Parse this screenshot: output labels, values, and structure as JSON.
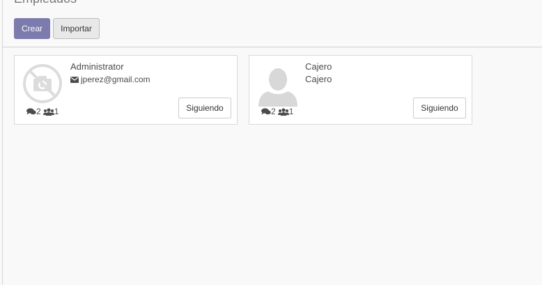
{
  "header": {
    "title": "Empleados",
    "create_label": "Crear",
    "import_label": "Importar"
  },
  "colors": {
    "primary": "#7c7bad",
    "background": "#f9f9f9"
  },
  "employees": [
    {
      "name": "Administrator",
      "email": "jperez@gmail.com",
      "messages": "2",
      "followers": "1",
      "follow_label": "Siguiendo",
      "avatar": "no-photo-camera-icon"
    },
    {
      "name": "Cajero",
      "job": "Cajero",
      "messages": "2",
      "followers": "1",
      "follow_label": "Siguiendo",
      "avatar": "person-silhouette-icon"
    }
  ]
}
